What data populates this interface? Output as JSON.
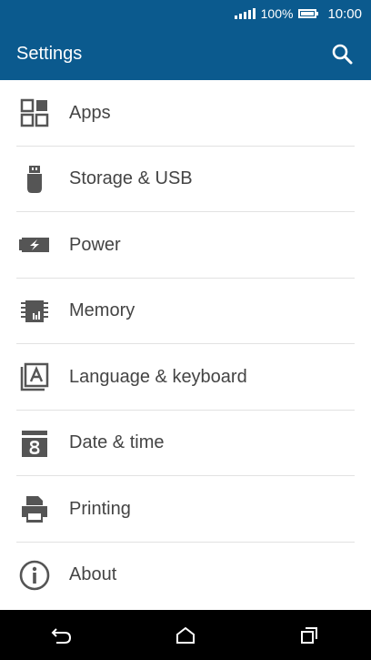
{
  "status_bar": {
    "battery_percent": "100%",
    "time": "10:00",
    "signal_icon": "signal-icon",
    "battery_icon": "battery-icon"
  },
  "app_bar": {
    "title": "Settings",
    "search_icon": "search-icon"
  },
  "settings_items": [
    {
      "label": "Apps",
      "icon": "apps-icon"
    },
    {
      "label": "Storage & USB",
      "icon": "usb-storage-icon"
    },
    {
      "label": "Power",
      "icon": "battery-charging-icon"
    },
    {
      "label": "Memory",
      "icon": "memory-chip-icon"
    },
    {
      "label": "Language & keyboard",
      "icon": "keyboard-language-icon"
    },
    {
      "label": "Date & time",
      "icon": "calendar-icon"
    },
    {
      "label": "Printing",
      "icon": "printer-icon"
    },
    {
      "label": "About",
      "icon": "info-icon"
    }
  ],
  "nav_bar": {
    "back_icon": "back-icon",
    "home_icon": "home-icon",
    "recents_icon": "recents-icon"
  },
  "colors": {
    "primary": "#0b5a8e",
    "icon_gray": "#555555",
    "text": "#444444",
    "divider": "#e2e2e2"
  }
}
